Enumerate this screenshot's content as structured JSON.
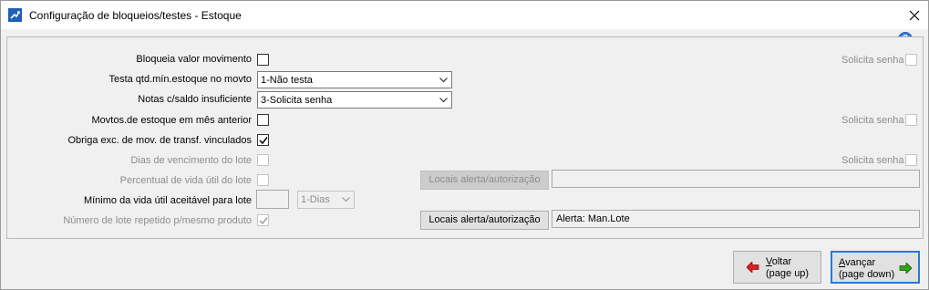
{
  "window": {
    "title": "Configuração de bloqueios/testes - Estoque",
    "icon": "app-icon",
    "close_icon": "close-icon"
  },
  "form": {
    "bloqueia_valor_movimento": {
      "label": "Bloqueia valor movimento",
      "checked": false
    },
    "testa_qtd_min": {
      "label": "Testa qtd.mín.estoque no movto",
      "value": "1-Não testa"
    },
    "notas_saldo_insuficiente": {
      "label": "Notas c/saldo insuficiente",
      "value": "3-Solicita senha"
    },
    "movtos_mes_anterior": {
      "label": "Movtos.de estoque em mês anterior",
      "checked": false
    },
    "obriga_exc_transf": {
      "label": "Obriga exc. de mov. de transf. vinculados",
      "checked": true
    },
    "dias_vencimento_lote": {
      "label": "Dias de vencimento do lote",
      "checked": false,
      "disabled": true
    },
    "percentual_vida_util": {
      "label": "Percentual de vida útil do lote",
      "checked": false,
      "disabled": true
    },
    "minimo_vida_util": {
      "label": "Mínimo da vida útil aceitável para lote",
      "value": "",
      "unit": "1-Dias"
    },
    "numero_lote_repetido": {
      "label": "Número de lote repetido p/mesmo produto",
      "checked": true,
      "disabled": true
    }
  },
  "solicita_senha": {
    "label": "Solicita senha",
    "row1": false,
    "row2": false,
    "row3": false
  },
  "locais": {
    "button1_label": "Locais alerta/autorização",
    "field1_value": "",
    "button2_label": "Locais alerta/autorização",
    "field2_value": "Alerta: Man.Lote"
  },
  "footer": {
    "voltar": {
      "label_underline": "V",
      "label_rest": "oltar",
      "sub": "(page up)",
      "icon": "arrow-left-icon",
      "icon_color": "#e02020"
    },
    "avancar": {
      "label_underline": "A",
      "label_rest": "vançar",
      "sub": "(page down)",
      "icon": "arrow-right-icon",
      "icon_color": "#2fa31a"
    }
  },
  "colors": {
    "accent": "#2b78d8",
    "help_icon": "#3b7fd1"
  }
}
